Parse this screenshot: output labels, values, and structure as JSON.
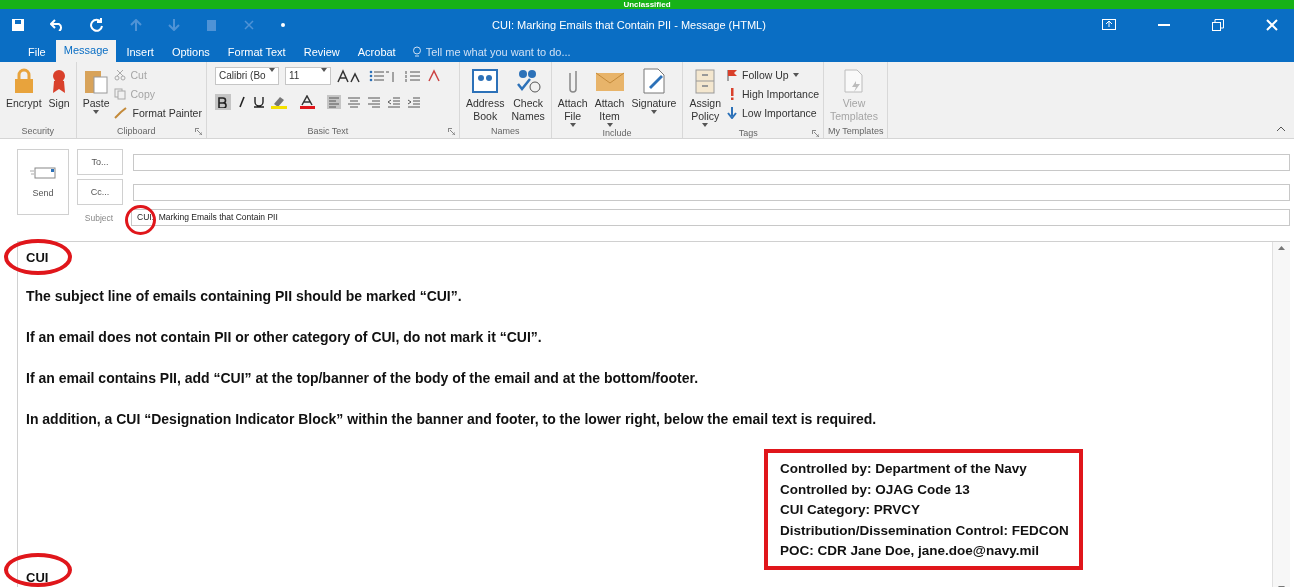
{
  "classification_banner": "Unclassified",
  "window": {
    "title": "CUI:  Marking Emails that Contain PII - Message (HTML)"
  },
  "tabs": [
    {
      "label": "File",
      "selected": false
    },
    {
      "label": "Message",
      "selected": true
    },
    {
      "label": "Insert",
      "selected": false
    },
    {
      "label": "Options",
      "selected": false
    },
    {
      "label": "Format Text",
      "selected": false
    },
    {
      "label": "Review",
      "selected": false
    },
    {
      "label": "Acrobat",
      "selected": false
    }
  ],
  "tell_me": {
    "placeholder": "Tell me what you want to do..."
  },
  "ribbon": {
    "groups": [
      {
        "name": "Security",
        "kind": "buttons",
        "launcher": false,
        "items": [
          {
            "kind": "large",
            "lines": [
              "Encrypt"
            ],
            "dropdown": false,
            "disabled": false
          },
          {
            "kind": "large",
            "lines": [
              "Sign"
            ],
            "dropdown": false,
            "disabled": false
          }
        ]
      },
      {
        "name": "Clipboard",
        "kind": "buttons",
        "launcher": true,
        "items": [
          {
            "kind": "large",
            "lines": [
              "Paste"
            ],
            "dropdown": true,
            "disabled": false
          },
          {
            "kind": "small",
            "lines": [
              "Cut"
            ],
            "dropdown": false,
            "disabled": true
          },
          {
            "kind": "small",
            "lines": [
              "Copy"
            ],
            "dropdown": false,
            "disabled": true
          },
          {
            "kind": "small",
            "lines": [
              "Format Painter"
            ],
            "dropdown": false,
            "disabled": false
          }
        ]
      },
      {
        "name": "Basic Text",
        "kind": "basic_text",
        "launcher": true,
        "font": "Calibri (Bo",
        "size": "11",
        "bold": true
      },
      {
        "name": "Names",
        "kind": "buttons",
        "launcher": false,
        "items": [
          {
            "kind": "large",
            "lines": [
              "Address",
              "Book"
            ],
            "dropdown": false,
            "disabled": false
          },
          {
            "kind": "large",
            "lines": [
              "Check",
              "Names"
            ],
            "dropdown": false,
            "disabled": false
          }
        ]
      },
      {
        "name": "Include",
        "kind": "buttons",
        "launcher": false,
        "items": [
          {
            "kind": "large",
            "lines": [
              "Attach",
              "File"
            ],
            "dropdown": true,
            "disabled": false
          },
          {
            "kind": "large",
            "lines": [
              "Attach",
              "Item"
            ],
            "dropdown": true,
            "disabled": false
          },
          {
            "kind": "large",
            "lines": [
              "Signature"
            ],
            "dropdown": true,
            "disabled": false
          }
        ]
      },
      {
        "name": "Tags",
        "kind": "buttons",
        "launcher": true,
        "items": [
          {
            "kind": "large",
            "lines": [
              "Assign",
              "Policy"
            ],
            "dropdown": true,
            "disabled": false
          },
          {
            "kind": "small",
            "lines": [
              "Follow Up"
            ],
            "dropdown": true,
            "disabled": false
          },
          {
            "kind": "small",
            "lines": [
              "High Importance"
            ],
            "dropdown": false,
            "disabled": false
          },
          {
            "kind": "small",
            "lines": [
              "Low Importance"
            ],
            "dropdown": false,
            "disabled": false
          }
        ]
      },
      {
        "name": "My Templates",
        "kind": "buttons",
        "launcher": false,
        "items": [
          {
            "kind": "large",
            "lines": [
              "View",
              "Templates"
            ],
            "dropdown": false,
            "disabled": true
          }
        ]
      }
    ]
  },
  "header": {
    "send": "Send",
    "to": "To...",
    "cc": "Cc...",
    "subject_label": "Subject",
    "subject": "CUI:  Marking Emails that Contain PII",
    "subject_prefix_circled": true
  },
  "body": {
    "banner": {
      "text": "CUI",
      "circled": true
    },
    "paragraphs": [
      "The subject line of emails containing PII should be marked “CUI”.",
      "If an email does not contain PII or other category of CUI, do not mark it “CUI”.",
      "If an email contains PII, add “CUI” at the top/banner of the body of the email and at the bottom/footer.",
      "In addition, a CUI “Designation Indicator Block” within the banner and footer, to the lower right, below the email text is required."
    ],
    "designation_block": {
      "outlined": true,
      "lines": [
        "Controlled by: Department of the Navy",
        "Controlled by: OJAG Code 13",
        "CUI Category:  PRVCY",
        "Distribution/Dissemination Control: FEDCON",
        "POC: CDR Jane Doe, jane.doe@navy.mil"
      ]
    },
    "footer": {
      "text": "CUI",
      "circled": true
    }
  }
}
